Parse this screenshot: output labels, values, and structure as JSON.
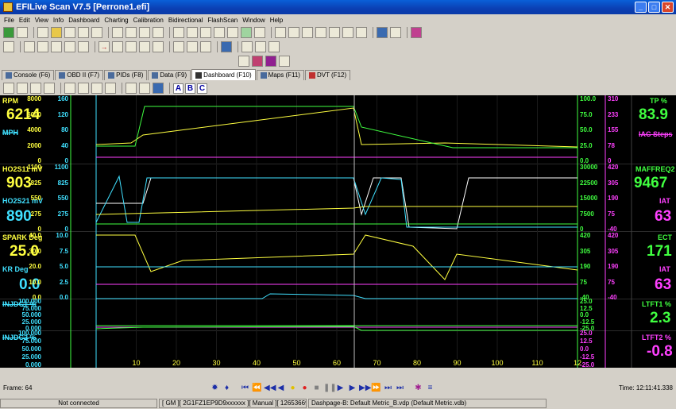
{
  "window": {
    "title": "EFILive Scan V7.5 [Perrone1.efi]",
    "minimize": "_",
    "maximize": "□",
    "close": "✕"
  },
  "menu": [
    "File",
    "Edit",
    "View",
    "Info",
    "Dashboard",
    "Charting",
    "Calibration",
    "Bidirectional",
    "FlashScan",
    "Window",
    "Help"
  ],
  "tabs": [
    {
      "label": "Console (F6)",
      "active": false
    },
    {
      "label": "OBD II (F7)",
      "active": false
    },
    {
      "label": "PIDs (F8)",
      "active": false
    },
    {
      "label": "Data (F9)",
      "active": false
    },
    {
      "label": "Dashboard (F10)",
      "active": true
    },
    {
      "label": "Maps (F11)",
      "active": false
    },
    {
      "label": "DVT (F12)",
      "active": false
    }
  ],
  "abc": [
    "A",
    "B",
    "C"
  ],
  "gauges": {
    "rpm": {
      "label": "RPM",
      "value": "6214",
      "sub": "MPH"
    },
    "ho2s11": {
      "label": "HO2S11 mV",
      "value": "903"
    },
    "ho2s21": {
      "label": "HO2S21 mV",
      "value": "890"
    },
    "spark": {
      "label": "SPARK Deg",
      "value": "25.0"
    },
    "kr": {
      "label": "KR Deg",
      "value": "0.0"
    },
    "injdc1": {
      "label": "INJDC1 %"
    },
    "injdc2": {
      "label": "INJDC2 %"
    },
    "tp": {
      "label": "TP %",
      "value": "83.9",
      "sub": "IAC Steps"
    },
    "maffreq": {
      "label": "MAFFREQ2",
      "value": "9467"
    },
    "iat1": {
      "label": "IAT",
      "value": "63"
    },
    "ect": {
      "label": "ECT",
      "value": "171"
    },
    "iat2": {
      "label": "IAT",
      "value": "63"
    },
    "ltft1": {
      "label": "LTFT1 %",
      "value": "2.3"
    },
    "ltft2": {
      "label": "LTFT2 %",
      "value": "-0.8"
    }
  },
  "axes": {
    "left1": [
      "8000",
      "6000",
      "4000",
      "2000",
      "0"
    ],
    "left2": [
      "160",
      "120",
      "80",
      "40",
      "0"
    ],
    "left3": [
      "1100",
      "825",
      "550",
      "275",
      "0"
    ],
    "left4": [
      "1100",
      "825",
      "550",
      "275",
      "0"
    ],
    "left5": [
      "40.0",
      "30.0",
      "20.0",
      "10.0",
      "0.0"
    ],
    "left6": [
      "10.0",
      "7.5",
      "5.0",
      "2.5",
      "0.0"
    ],
    "left7": [
      "100.000",
      "75.000",
      "50.000",
      "25.000",
      "0.000"
    ],
    "left8": [
      "100.000",
      "75.000",
      "50.000",
      "25.000",
      "0.000"
    ],
    "right1": [
      "100.0",
      "75.0",
      "50.0",
      "25.0",
      "0.0"
    ],
    "right2": [
      "310",
      "233",
      "155",
      "78",
      "0"
    ],
    "right3": [
      "30000",
      "22500",
      "15000",
      "7500",
      "0"
    ],
    "right4": [
      "420",
      "305",
      "190",
      "75",
      "-40"
    ],
    "right5": [
      "420",
      "305",
      "190",
      "75",
      "-40"
    ],
    "right6": [
      "420",
      "305",
      "190",
      "75",
      "-40"
    ],
    "right7": [
      "25.0",
      "12.5",
      "0.0",
      "-12.5",
      "-25.0"
    ],
    "right8": [
      "25.0",
      "12.5",
      "0.0",
      "-12.5",
      "-25.0"
    ],
    "xticks": [
      "10",
      "20",
      "30",
      "40",
      "50",
      "60",
      "70",
      "80",
      "90",
      "100",
      "110",
      "12"
    ]
  },
  "status": {
    "frame": "Frame: 64",
    "time": "Time: 12:11:41.338"
  },
  "bottom": {
    "conn": "Not connected",
    "vehicle": "[ GM ][ 2G1FZ1EP9D9xxxxxx ][ Manual ][ 12653669 ]",
    "dash": "Dashpage-B: Default Metric_B.vdp (Default Metric.vdb)"
  },
  "colors": {
    "rpm": "#ffff40",
    "mph": "#40e0ff",
    "green": "#40ff40",
    "magenta": "#ff40ff",
    "white": "#ffffff",
    "cursor": "#c0c0c0"
  }
}
